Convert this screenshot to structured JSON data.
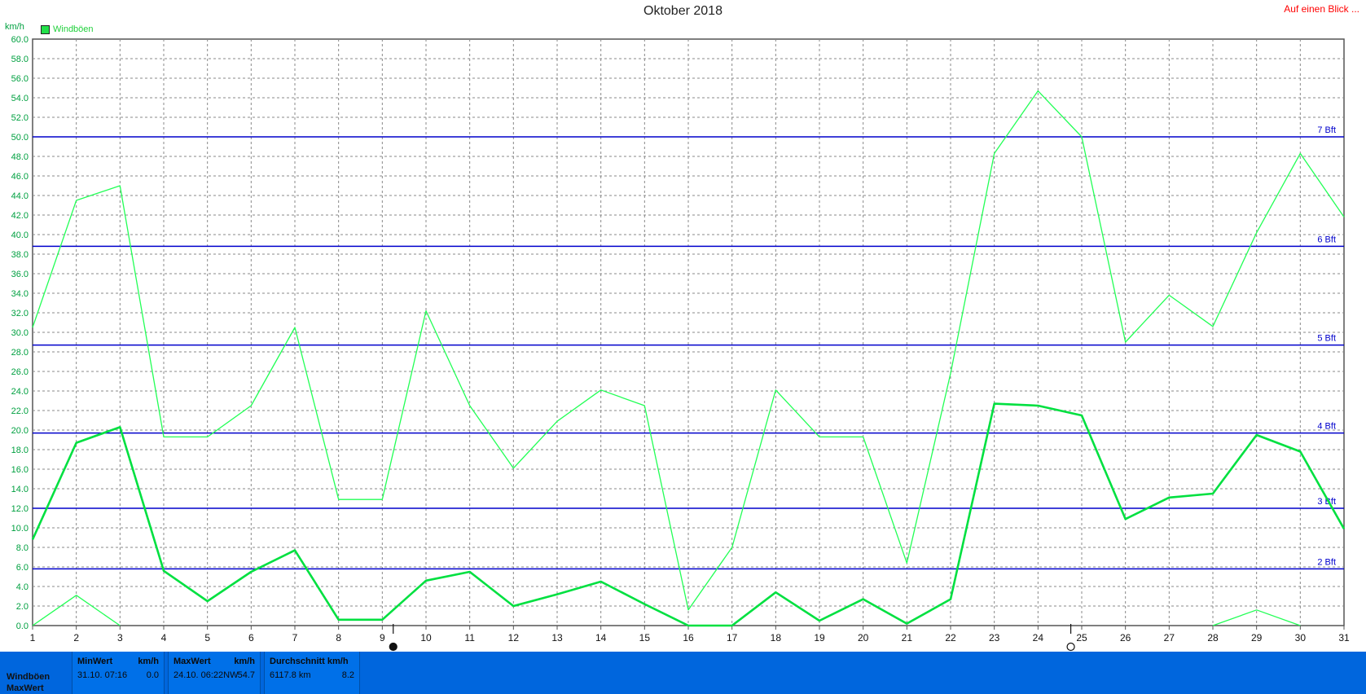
{
  "header": {
    "title": "Oktober 2018",
    "link": "Auf einen Blick ...",
    "unit": "km/h",
    "legend_label": "Windböen"
  },
  "chart_data": {
    "type": "line",
    "x": [
      1,
      2,
      3,
      4,
      5,
      6,
      7,
      8,
      9,
      10,
      11,
      12,
      13,
      14,
      15,
      16,
      17,
      18,
      19,
      20,
      21,
      22,
      23,
      24,
      25,
      26,
      27,
      28,
      29,
      30,
      31
    ],
    "ylim": [
      0,
      60
    ],
    "ytick_step": 2,
    "grid": true,
    "colors": {
      "max_line": "#22ff55",
      "avg_line": "#00e040",
      "beaufort": "#0000cc",
      "axis_text": "#00a040"
    },
    "series": [
      {
        "name": "",
        "values": [
          30.5,
          43.5,
          45.0,
          19.3,
          19.3,
          22.5,
          30.5,
          12.9,
          12.9,
          32.2,
          22.5,
          16.1,
          20.9,
          24.1,
          22.5,
          1.6,
          8.0,
          24.1,
          19.3,
          19.3,
          6.4,
          25.8,
          48.3,
          54.7,
          50.0,
          29.0,
          33.8,
          30.6,
          40.2,
          48.3,
          41.8
        ]
      },
      {
        "name": "",
        "values": [
          8.8,
          18.7,
          20.3,
          5.6,
          2.5,
          5.5,
          7.7,
          0.6,
          0.6,
          4.6,
          5.5,
          2.0,
          3.2,
          4.5,
          2.2,
          0.0,
          0.0,
          3.4,
          0.5,
          2.7,
          0.2,
          2.7,
          22.7,
          22.5,
          21.5,
          10.9,
          13.1,
          13.5,
          19.5,
          17.8,
          9.9
        ]
      },
      {
        "name": "",
        "values": [
          0.0,
          3.1,
          0.0,
          null,
          null,
          null,
          null,
          null,
          null,
          null,
          null,
          null,
          null,
          null,
          null,
          null,
          null,
          null,
          null,
          null,
          null,
          null,
          null,
          null,
          null,
          null,
          null,
          0.0,
          1.6,
          0.0,
          null
        ]
      }
    ],
    "beaufort_lines": [
      {
        "label": "7 Bft",
        "value": 50.0
      },
      {
        "label": "6 Bft",
        "value": 38.8
      },
      {
        "label": "5 Bft",
        "value": 28.7
      },
      {
        "label": "4 Bft",
        "value": 19.7
      },
      {
        "label": "3 Bft",
        "value": 12.0
      },
      {
        "label": "2 Bft",
        "value": 5.8
      }
    ],
    "moon_markers": [
      {
        "x": 9.25,
        "phase": "new-moon"
      },
      {
        "x": 24.75,
        "phase": "full-moon"
      }
    ]
  },
  "stats": {
    "row_label_1": "Windböen",
    "row_label_2": "MaxWert",
    "min": {
      "header": "MinWert",
      "unit": "km/h",
      "when": "31.10.  07:16",
      "value": "0.0"
    },
    "max": {
      "header": "MaxWert",
      "unit": "km/h",
      "when": "24.10.  06:22NW",
      "value": "54.7"
    },
    "avg": {
      "header": "Durchschnitt km/h",
      "unit": "",
      "when": "6117.8 km",
      "value": "8.2"
    }
  }
}
